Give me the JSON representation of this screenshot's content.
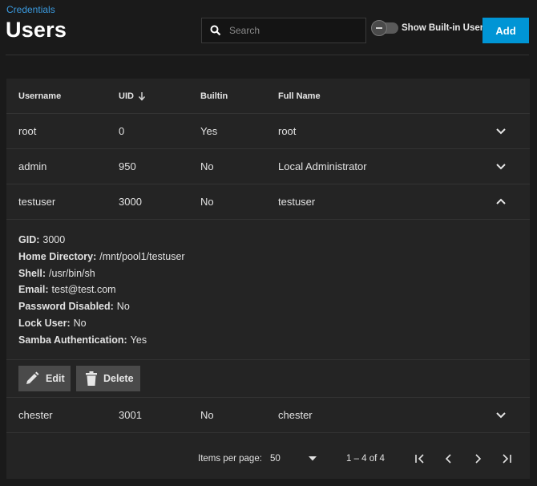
{
  "breadcrumb": "Credentials",
  "title": "Users",
  "search": {
    "placeholder": "Search",
    "value": ""
  },
  "toggle": {
    "label": "Show Built-in Users"
  },
  "add_label": "Add",
  "columns": {
    "username": "Username",
    "uid": "UID",
    "builtin": "Builtin",
    "full_name": "Full Name"
  },
  "rows": [
    {
      "username": "root",
      "uid": "0",
      "builtin": "Yes",
      "full_name": "root"
    },
    {
      "username": "admin",
      "uid": "950",
      "builtin": "No",
      "full_name": "Local Administrator"
    },
    {
      "username": "testuser",
      "uid": "3000",
      "builtin": "No",
      "full_name": "testuser"
    },
    {
      "username": "chester",
      "uid": "3001",
      "builtin": "No",
      "full_name": "chester"
    }
  ],
  "details": [
    {
      "key": "GID:",
      "value": "3000"
    },
    {
      "key": "Home Directory:",
      "value": "/mnt/pool1/testuser"
    },
    {
      "key": "Shell:",
      "value": "/usr/bin/sh"
    },
    {
      "key": "Email:",
      "value": "test@test.com"
    },
    {
      "key": "Password Disabled:",
      "value": "No"
    },
    {
      "key": "Lock User:",
      "value": "No"
    },
    {
      "key": "Samba Authentication:",
      "value": "Yes"
    }
  ],
  "actions": {
    "edit": "Edit",
    "delete": "Delete"
  },
  "pager": {
    "items_label": "Items per page:",
    "page_size": "50",
    "range": "1 – 4 of 4"
  },
  "icons": [
    "search-icon",
    "sort-arrow-down-icon",
    "chevron-down-icon",
    "chevron-up-icon",
    "pencil-icon",
    "trash-icon",
    "first-page-icon",
    "prev-page-icon",
    "next-page-icon",
    "last-page-icon",
    "dropdown-arrow-icon"
  ]
}
